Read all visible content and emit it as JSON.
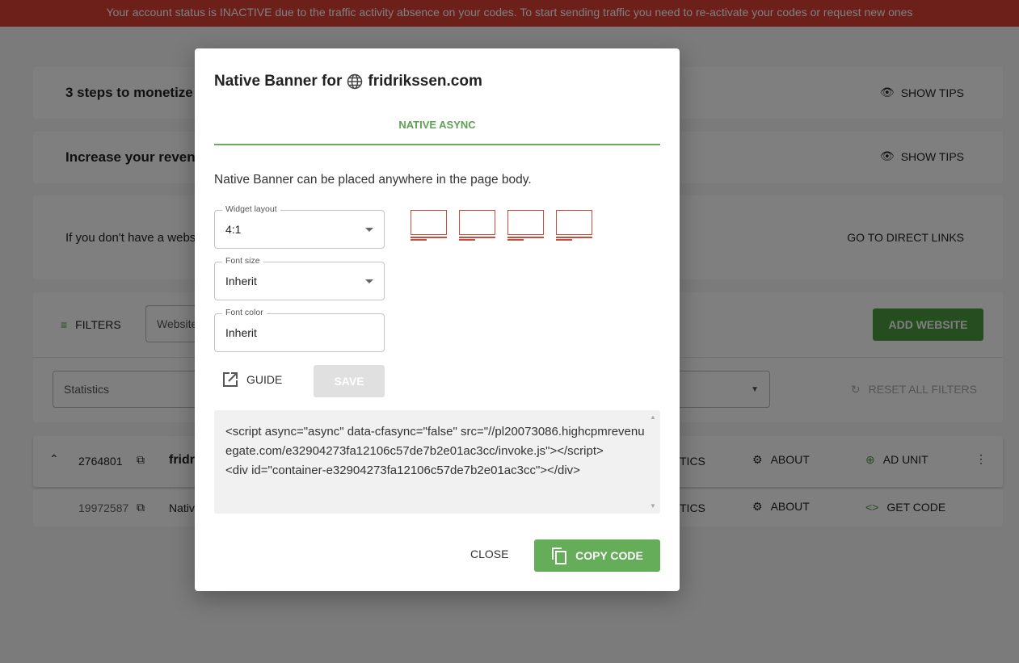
{
  "banner": {
    "text": "Your account status is INACTIVE due to the traffic activity absence on your codes. To start sending traffic you need to re-activate your codes or request new ones",
    "color": "#d84033"
  },
  "page": {
    "steps_title": "3 steps to monetize",
    "increase_title": "Increase your reven",
    "show_tips": "SHOW TIPS",
    "no_website_text": "If you don't have a webs",
    "direct_links": "GO TO DIRECT LINKS",
    "filters": "FILTERS",
    "website_placeholder": "Website",
    "add_website": "ADD WEBSITE",
    "statistics_select": "Statistics",
    "reset_filters": "RESET ALL FILTERS",
    "site_row": {
      "id": "2764801",
      "name": "fridri",
      "stats": "TICS",
      "about": "ABOUT",
      "ad_unit": "AD UNIT"
    },
    "unit_row": {
      "id": "19972587",
      "name": "Nativ",
      "stats": "TICS",
      "about": "ABOUT",
      "get_code": "GET CODE"
    }
  },
  "modal": {
    "title": "Native Banner for",
    "domain": "fridrikssen.com",
    "tab": "NATIVE ASYNC",
    "description": "Native Banner can be placed anywhere in the page body.",
    "widget_layout": {
      "label": "Widget layout",
      "value": "4:1"
    },
    "font_size": {
      "label": "Font size",
      "value": "Inherit"
    },
    "font_color": {
      "label": "Font color",
      "value": "Inherit"
    },
    "guide": "GUIDE",
    "save": "SAVE",
    "code": "<script async=\"async\" data-cfasync=\"false\" src=\"//pl20073086.highcpmrevenuegate.com/e32904273fa12106c57de7b2e01ac3cc/invoke.js\"></script>\n<div id=\"container-e32904273fa12106c57de7b2e01ac3cc\"></div>",
    "close": "CLOSE",
    "copy_code": "COPY CODE",
    "accent": "#65ad58"
  }
}
